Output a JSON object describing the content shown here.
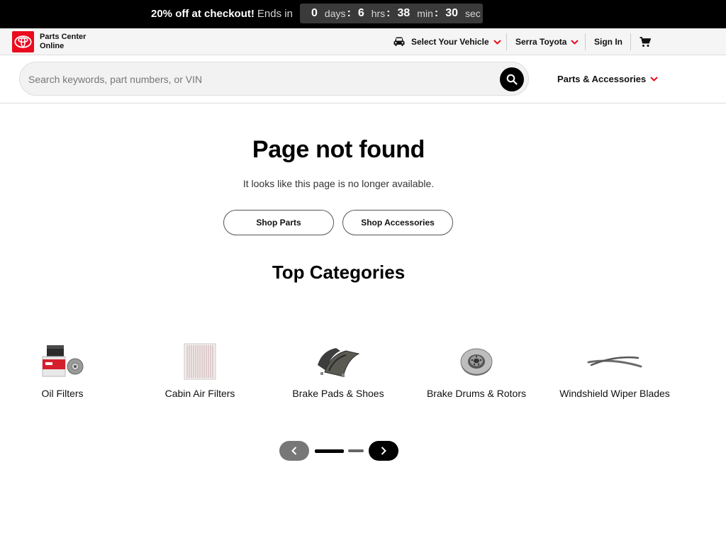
{
  "promo": {
    "bold_text": "20% off at checkout!",
    "ends_text": "Ends in",
    "countdown": [
      {
        "value": "0",
        "unit": "days"
      },
      {
        "value": "6",
        "unit": "hrs"
      },
      {
        "value": "38",
        "unit": "min"
      },
      {
        "value": "30",
        "unit": "sec"
      }
    ],
    "separator": ":"
  },
  "header": {
    "logo_line1": "Parts Center",
    "logo_line2": "Online",
    "select_vehicle": "Select Your Vehicle",
    "dealer": "Serra Toyota",
    "sign_in": "Sign In",
    "accent_color": "#eb0a1e"
  },
  "search": {
    "placeholder": "Search keywords, part numbers, or VIN",
    "value": ""
  },
  "nav": {
    "parts_accessories": "Parts & Accessories"
  },
  "main": {
    "title": "Page not found",
    "subtitle": "It looks like this page is no longer available.",
    "shop_parts": "Shop Parts",
    "shop_accessories": "Shop Accessories",
    "top_categories": "Top Categories"
  },
  "categories": [
    {
      "label": "Oil Filters",
      "icon": "oil-filter-icon"
    },
    {
      "label": "Cabin Air Filters",
      "icon": "cabin-air-filter-icon"
    },
    {
      "label": "Brake Pads & Shoes",
      "icon": "brake-pads-icon"
    },
    {
      "label": "Brake Drums & Rotors",
      "icon": "brake-rotor-icon"
    },
    {
      "label": "Windshield Wiper Blades",
      "icon": "wiper-blades-icon"
    }
  ]
}
